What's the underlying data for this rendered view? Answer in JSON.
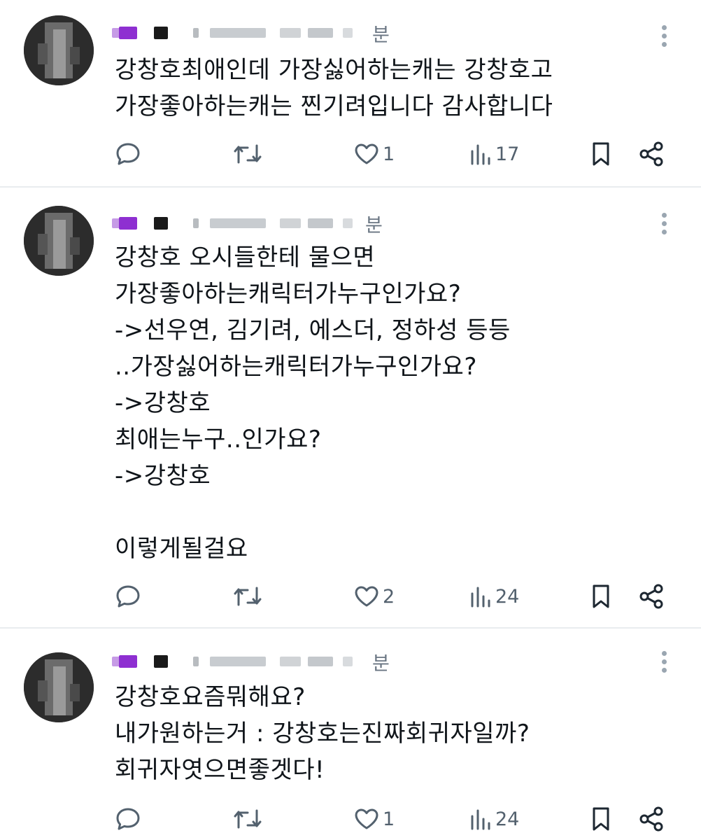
{
  "tweets": [
    {
      "time": "분",
      "text": "강창호최애인데 가장싫어하는캐는 강창호고\n가장좋아하는캐는 찐기려입니다 감사합니다",
      "stats": {
        "replies": "",
        "retweets": "",
        "likes": "1",
        "views": "17"
      }
    },
    {
      "time": "분",
      "text": "강창호 오시들한테 물으면\n가장좋아하는캐릭터가누구인가요?\n->선우연, 김기려, 에스더, 정하성 등등\n..가장싫어하는캐릭터가누구인가요?\n->강창호\n최애는누구..인가요?\n->강창호\n\n이렇게될걸요",
      "stats": {
        "replies": "",
        "retweets": "",
        "likes": "2",
        "views": "24"
      }
    },
    {
      "time": "분",
      "text": "강창호요즘뭐해요?\n내가원하는거 : 강창호는진짜회귀자일까?\n회귀자엿으면좋겟다!",
      "stats": {
        "replies": "",
        "retweets": "",
        "likes": "1",
        "views": "24"
      }
    }
  ],
  "icons": {
    "reply": "reply-icon",
    "retweet": "retweet-icon",
    "like": "heart-icon",
    "views": "bar-chart-icon",
    "bookmark": "bookmark-icon",
    "share": "share-icon",
    "more": "more-icon"
  },
  "colors": {
    "name_accent": "#9a3ccf",
    "icon_gray": "#53616e",
    "divider": "#e9ecef"
  }
}
